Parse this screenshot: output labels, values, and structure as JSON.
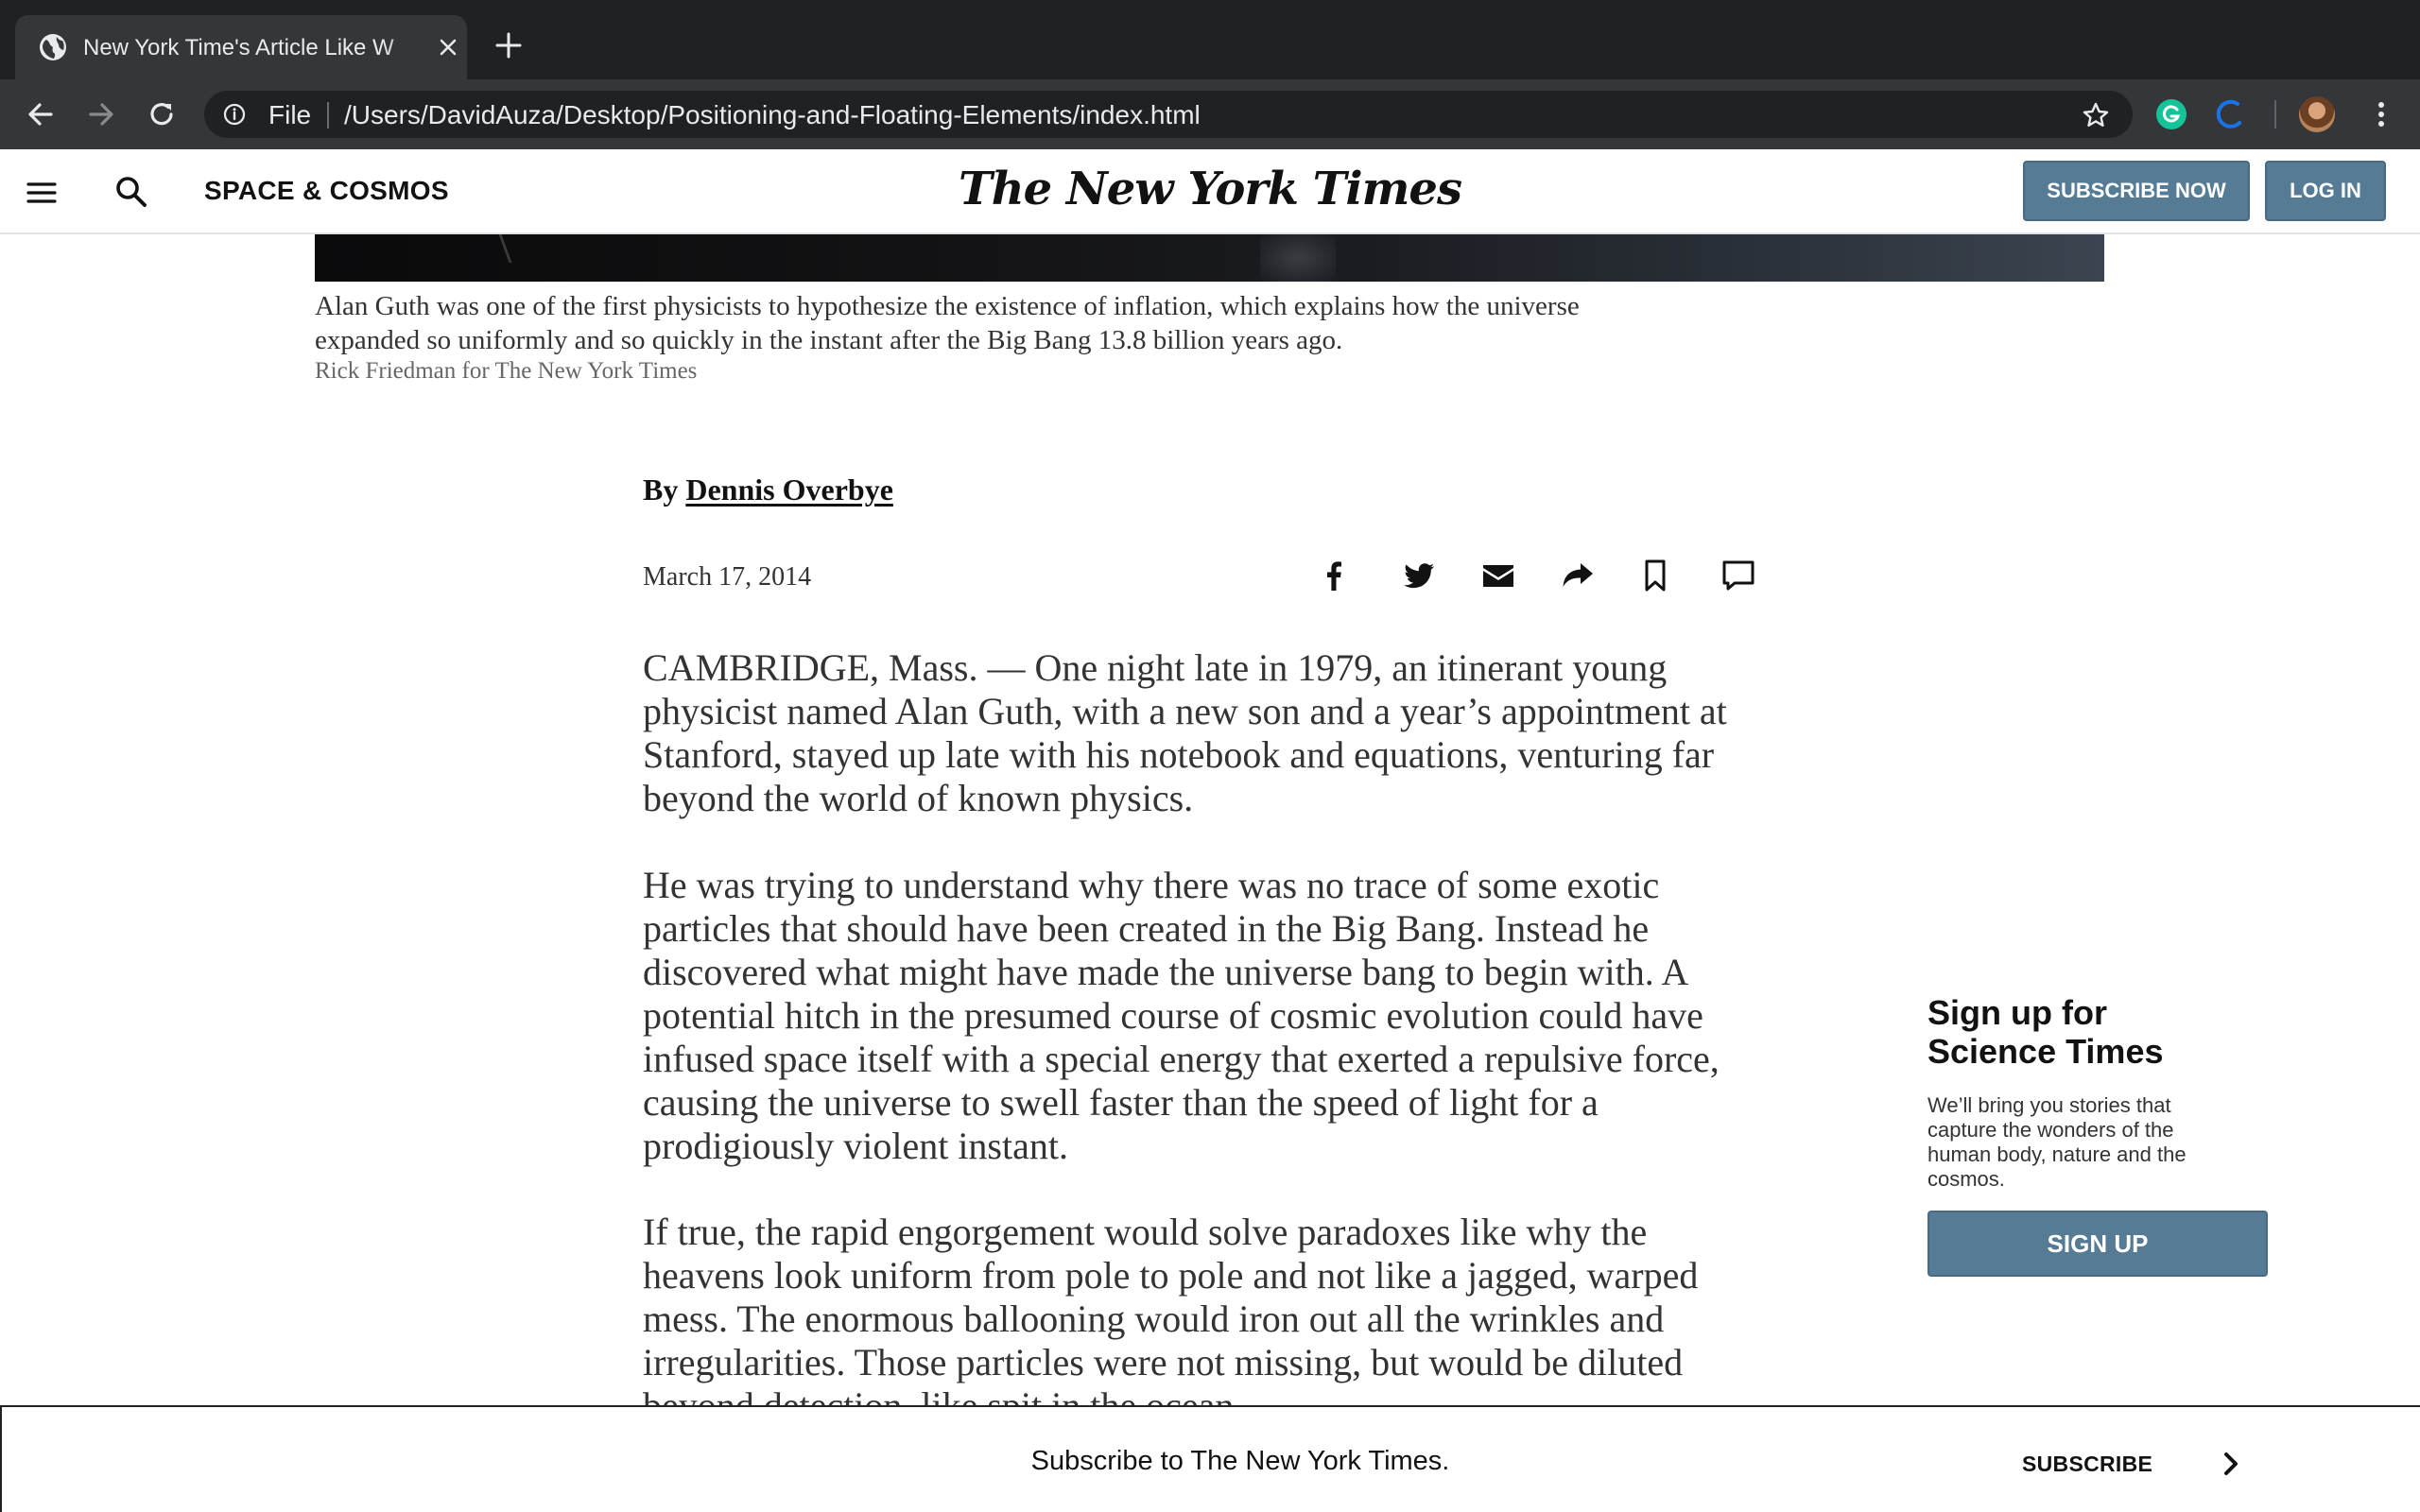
{
  "browser": {
    "tab_title": "New York Time's Article Like W",
    "address_scheme_label": "File",
    "address_url": "/Users/DavidAuza/Desktop/Positioning-and-Floating-Elements/index.html",
    "icons": [
      "globe-icon",
      "close-icon",
      "plus-icon",
      "back-arrow-icon",
      "forward-arrow-icon",
      "reload-icon",
      "info-icon",
      "star-icon",
      "grammarly-icon",
      "extension-c-icon",
      "avatar",
      "more-vert-icon"
    ],
    "colors": {
      "tabstrip": "#202124",
      "toolbar": "#35363a",
      "text": "#e8eaed",
      "grammarly": "#15c39a",
      "extension_c": "#1a73e8"
    }
  },
  "header": {
    "section": "SPACE & COSMOS",
    "logo": "The New York Times",
    "subscribe_label": "SUBSCRIBE NOW",
    "login_label": "LOG IN",
    "accent_color": "#567b95"
  },
  "article": {
    "caption": "Alan Guth was one of the first physicists to hypothesize the existence of inflation, which explains how the universe expanded so uniformly and so quickly in the instant after the Big Bang 13.8 billion years ago.",
    "credit": "Rick Friedman for The New York Times",
    "byline_prefix": "By ",
    "author": "Dennis Overbye",
    "date": "March 17, 2014",
    "share_icons": [
      "facebook-icon",
      "twitter-icon",
      "email-icon",
      "share-icon",
      "bookmark-icon",
      "comment-icon"
    ],
    "paragraphs": [
      "CAMBRIDGE, Mass. — One night late in 1979, an itinerant young physicist named Alan Guth, with a new son and a year’s appointment at Stanford, stayed up late with his notebook and equations, venturing far beyond the world of known physics.",
      "He was trying to understand why there was no trace of some exotic particles that should have been created in the Big Bang. Instead he discovered what might have made the universe bang to begin with. A potential hitch in the presumed course of cosmic evolution could have infused space itself with a special energy that exerted a repulsive force, causing the universe to swell faster than the speed of light for a prodigiously violent instant.",
      "If true, the rapid engorgement would solve paradoxes like why the heavens look uniform from pole to pole and not like a jagged, warped mess. The enormous ballooning would iron out all the wrinkles and irregularities. Those particles were not missing, but would be diluted beyond detection, like spit in the ocean."
    ]
  },
  "sidebar": {
    "title": "Sign up for Science Times",
    "description": "We’ll bring you stories that capture the wonders of the human body, nature and the cosmos.",
    "button_label": "SIGN UP"
  },
  "subscribe_bar": {
    "text": "Subscribe to The New York Times.",
    "link_label": "SUBSCRIBE"
  }
}
